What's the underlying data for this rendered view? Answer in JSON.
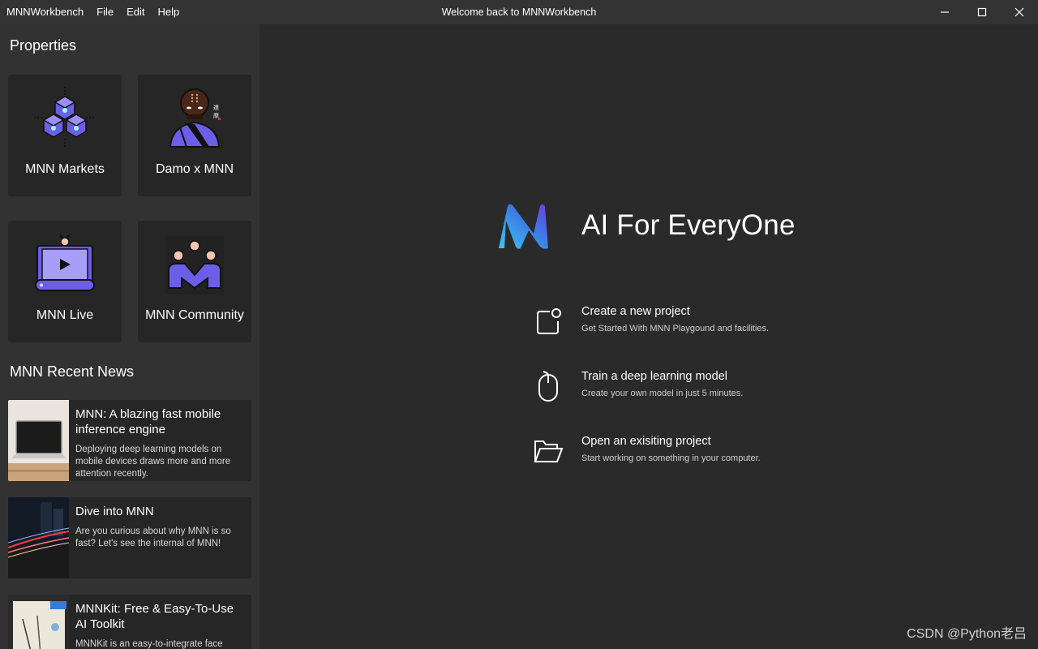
{
  "titlebar": {
    "app_name": "MNNWorkbench",
    "menu": [
      "File",
      "Edit",
      "Help"
    ],
    "window_title": "Welcome back to MNNWorkbench"
  },
  "sidebar": {
    "properties_title": "Properties",
    "tiles": [
      {
        "label": "MNN Markets",
        "icon": "cubes-icon"
      },
      {
        "label": "Damo x MNN",
        "icon": "monk-icon"
      },
      {
        "label": "MNN Live",
        "icon": "tv-play-icon"
      },
      {
        "label": "MNN Community",
        "icon": "community-icon"
      }
    ],
    "news_title": "MNN Recent News",
    "news": [
      {
        "title": "MNN: A blazing fast mobile inference engine",
        "desc": "Deploying deep learning models on mobile devices draws more and more attention recently."
      },
      {
        "title": "Dive into MNN",
        "desc": "Are you curious about why MNN is so fast? Let's see the internal of MNN!"
      },
      {
        "title": "MNNKit: Free & Easy-To-Use AI Toolkit",
        "desc": "MNNKit is an easy-to-integrate face"
      }
    ]
  },
  "main": {
    "hero": "AI For EveryOne",
    "actions": [
      {
        "title": "Create a new project",
        "desc": "Get Started With MNN Playgound and facilities.",
        "icon": "new-project-icon"
      },
      {
        "title": "Train a deep learning model",
        "desc": "Create your own model in just 5 minutes.",
        "icon": "mouse-icon"
      },
      {
        "title": "Open an exisiting project",
        "desc": "Start working on something in your computer.",
        "icon": "folder-open-icon"
      }
    ]
  },
  "watermark": "CSDN @Python老吕",
  "colors": {
    "accent": "#6d5ee8",
    "background": "#2a2a2a",
    "sidebar": "#323232",
    "tile": "#262626"
  }
}
